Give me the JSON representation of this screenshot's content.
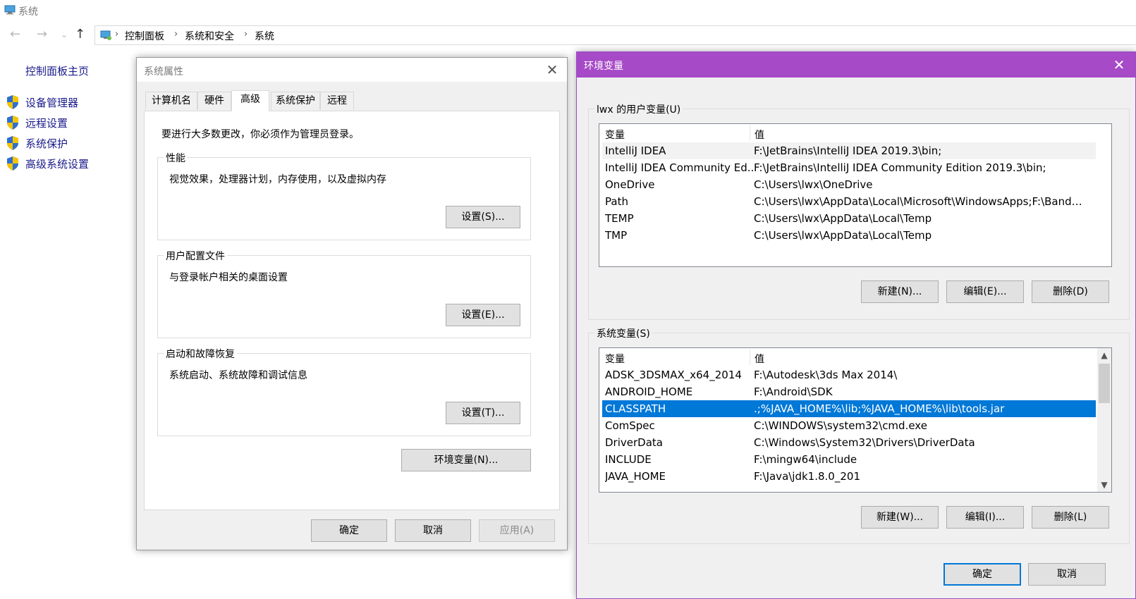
{
  "control_panel": {
    "window_title": "系统",
    "breadcrumb": [
      "控制面板",
      "系统和安全",
      "系统"
    ],
    "sidebar": {
      "home": "控制面板主页",
      "items": [
        {
          "label": "设备管理器",
          "icon": "shield-icon"
        },
        {
          "label": "远程设置",
          "icon": "shield-icon"
        },
        {
          "label": "系统保护",
          "icon": "shield-icon"
        },
        {
          "label": "高级系统设置",
          "icon": "shield-icon"
        }
      ]
    }
  },
  "system_properties": {
    "title": "系统属性",
    "tabs": [
      "计算机名",
      "硬件",
      "高级",
      "系统保护",
      "远程"
    ],
    "active_tab": "高级",
    "admin_note": "要进行大多数更改，你必须作为管理员登录。",
    "groups": [
      {
        "title": "性能",
        "desc": "视觉效果，处理器计划，内存使用，以及虚拟内存",
        "button": "设置(S)..."
      },
      {
        "title": "用户配置文件",
        "desc": "与登录帐户相关的桌面设置",
        "button": "设置(E)..."
      },
      {
        "title": "启动和故障恢复",
        "desc": "系统启动、系统故障和调试信息",
        "button": "设置(T)..."
      }
    ],
    "env_button": "环境变量(N)...",
    "ok": "确定",
    "cancel": "取消",
    "apply": "应用(A)"
  },
  "environment_variables": {
    "title": "环境变量",
    "user_section": {
      "title": "lwx 的用户变量(U)",
      "col_var": "变量",
      "col_val": "值",
      "rows": [
        {
          "name": "IntelliJ IDEA",
          "value": "F:\\JetBrains\\IntelliJ IDEA 2019.3\\bin;"
        },
        {
          "name": "IntelliJ IDEA Community Ed...",
          "value": "F:\\JetBrains\\IntelliJ IDEA Community Edition 2019.3\\bin;"
        },
        {
          "name": "OneDrive",
          "value": "C:\\Users\\lwx\\OneDrive"
        },
        {
          "name": "Path",
          "value": "C:\\Users\\lwx\\AppData\\Local\\Microsoft\\WindowsApps;F:\\Bandzi..."
        },
        {
          "name": "TEMP",
          "value": "C:\\Users\\lwx\\AppData\\Local\\Temp"
        },
        {
          "name": "TMP",
          "value": "C:\\Users\\lwx\\AppData\\Local\\Temp"
        }
      ],
      "buttons": {
        "new": "新建(N)...",
        "edit": "编辑(E)...",
        "delete": "删除(D)"
      }
    },
    "system_section": {
      "title": "系统变量(S)",
      "col_var": "变量",
      "col_val": "值",
      "selected": "CLASSPATH",
      "rows": [
        {
          "name": "ADSK_3DSMAX_x64_2014",
          "value": "F:\\Autodesk\\3ds Max 2014\\"
        },
        {
          "name": "ANDROID_HOME",
          "value": "F:\\Android\\SDK"
        },
        {
          "name": "CLASSPATH",
          "value": ".;%JAVA_HOME%\\lib;%JAVA_HOME%\\lib\\tools.jar"
        },
        {
          "name": "ComSpec",
          "value": "C:\\WINDOWS\\system32\\cmd.exe"
        },
        {
          "name": "DriverData",
          "value": "C:\\Windows\\System32\\Drivers\\DriverData"
        },
        {
          "name": "INCLUDE",
          "value": "F:\\mingw64\\include"
        },
        {
          "name": "JAVA_HOME",
          "value": "F:\\Java\\jdk1.8.0_201"
        }
      ],
      "buttons": {
        "new": "新建(W)...",
        "edit": "编辑(I)...",
        "delete": "删除(L)"
      }
    },
    "ok": "确定",
    "cancel": "取消"
  },
  "colors": {
    "env_titlebar": "#a74ac7",
    "selection": "#0078d7",
    "link": "#1a1a8c"
  }
}
